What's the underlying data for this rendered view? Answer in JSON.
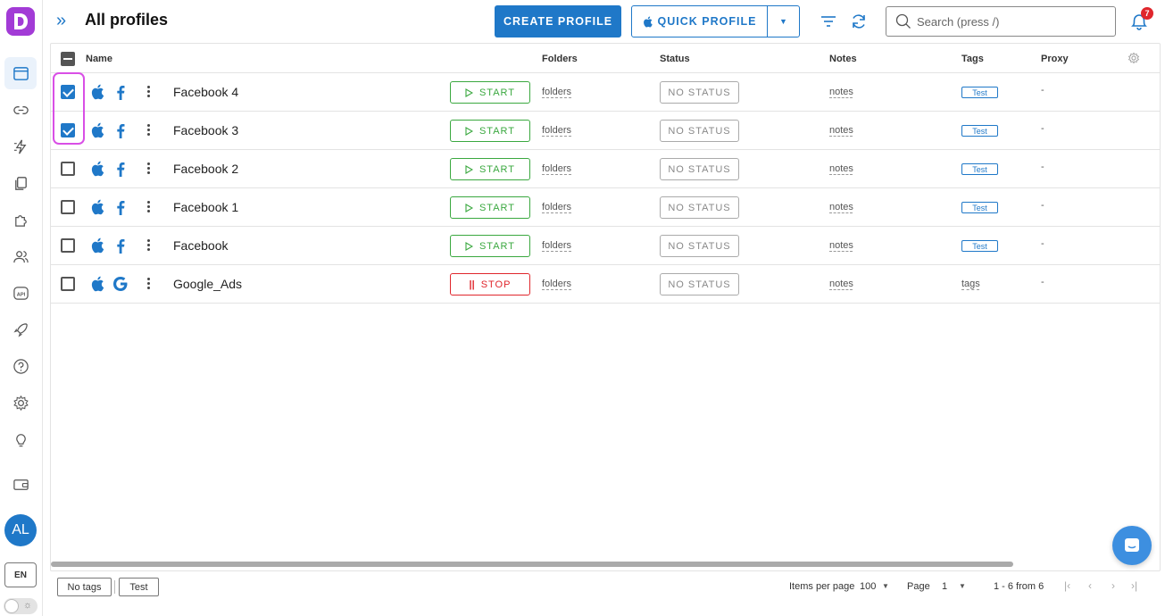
{
  "header": {
    "title": "All profiles",
    "create_label": "CREATE PROFILE",
    "quick_label": "QUICK PROFILE",
    "search_placeholder": "Search (press /)",
    "notif_count": "7"
  },
  "sidebar": {
    "avatar": "AL",
    "lang": "EN"
  },
  "table": {
    "columns": {
      "name": "Name",
      "folders": "Folders",
      "status": "Status",
      "notes": "Notes",
      "tags": "Tags",
      "proxy": "Proxy"
    },
    "rows": [
      {
        "name": "Facebook 4",
        "browser": "facebook",
        "action": "START",
        "folders": "folders",
        "status": "NO STATUS",
        "notes": "notes",
        "tag": "Test",
        "proxy": "-",
        "checked": true
      },
      {
        "name": "Facebook 3",
        "browser": "facebook",
        "action": "START",
        "folders": "folders",
        "status": "NO STATUS",
        "notes": "notes",
        "tag": "Test",
        "proxy": "-",
        "checked": true
      },
      {
        "name": "Facebook 2",
        "browser": "facebook",
        "action": "START",
        "folders": "folders",
        "status": "NO STATUS",
        "notes": "notes",
        "tag": "Test",
        "proxy": "-",
        "checked": false
      },
      {
        "name": "Facebook 1",
        "browser": "facebook",
        "action": "START",
        "folders": "folders",
        "status": "NO STATUS",
        "notes": "notes",
        "tag": "Test",
        "proxy": "-",
        "checked": false
      },
      {
        "name": "Facebook",
        "browser": "facebook",
        "action": "START",
        "folders": "folders",
        "status": "NO STATUS",
        "notes": "notes",
        "tag": "Test",
        "proxy": "-",
        "checked": false
      },
      {
        "name": "Google_Ads",
        "browser": "google",
        "action": "STOP",
        "folders": "folders",
        "status": "NO STATUS",
        "notes": "notes",
        "tag": "tags",
        "proxy": "-",
        "checked": false
      }
    ]
  },
  "footer": {
    "tag_filters": [
      "No tags",
      "Test"
    ],
    "items_per_page_label": "Items per page",
    "items_per_page": "100",
    "page_label": "Page",
    "page": "1",
    "range": "1 - 6 from 6"
  },
  "colors": {
    "accent": "#1f78c8",
    "start": "#3aa83f",
    "stop": "#e0262c",
    "brand": "#a23bd6",
    "selection_outline": "#d94fe6"
  }
}
